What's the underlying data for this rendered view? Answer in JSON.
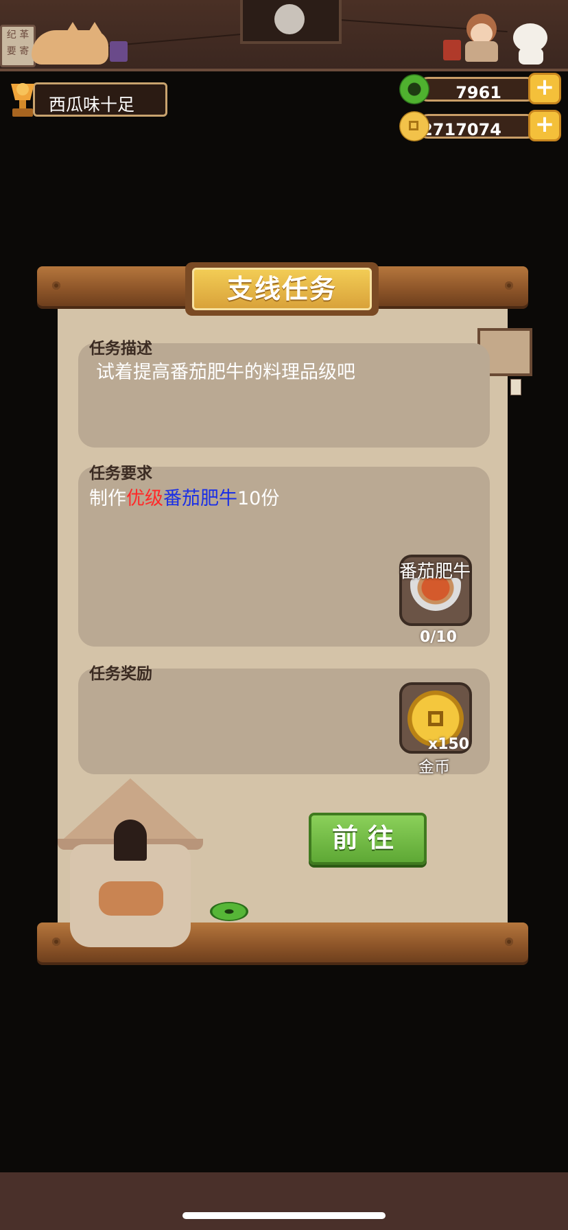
{
  "header": {
    "sign_text": "纪 革 要 寄",
    "player_name": "西瓜味十足"
  },
  "currency": {
    "jade": {
      "icon": "jade-icon",
      "value": "7961",
      "add_label": "+"
    },
    "gold": {
      "icon": "coin-icon",
      "value": "2717074",
      "add_label": "+"
    }
  },
  "dialog": {
    "title": "支线任务",
    "description": {
      "label": "任务描述",
      "text": "试着提高番茄肥牛的料理品级吧"
    },
    "requirement": {
      "label": "任务要求",
      "prefix": "制作",
      "quality": "优级",
      "dish": "番茄肥牛",
      "suffix": "10份",
      "item_name": "番茄肥牛",
      "progress": "0/10"
    },
    "reward": {
      "label": "任务奖励",
      "amount": "x150",
      "item_name": "金币"
    },
    "go_button": "前往"
  },
  "colors": {
    "quality_text": "#ff2a2a",
    "dish_text": "#1a2fe6",
    "paper": "#d4c3a8",
    "go_button": "#6cb83f"
  }
}
